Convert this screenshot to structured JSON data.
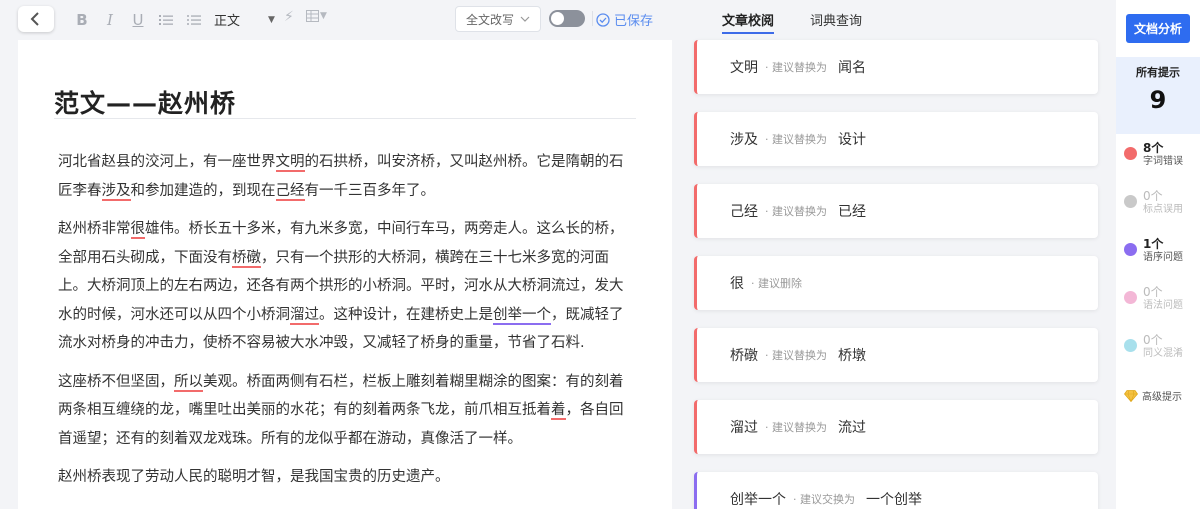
{
  "toolbar": {
    "style_label": "正文",
    "rewrite_label": "全文改写",
    "saved_label": "已保存"
  },
  "document": {
    "title": "范文——赵州桥",
    "paragraphs": [
      [
        {
          "t": "河北省赵县的洨河上，有一座世界"
        },
        {
          "t": "文明",
          "m": "err"
        },
        {
          "t": "的石拱桥，叫安济桥，又叫赵州桥。它是隋朝的石匠李春"
        },
        {
          "t": "涉及",
          "m": "err"
        },
        {
          "t": "和参加建造的，到现在"
        },
        {
          "t": "己经",
          "m": "err"
        },
        {
          "t": "有一千三百多年了。"
        }
      ],
      [
        {
          "t": "赵州桥非常"
        },
        {
          "t": "很",
          "m": "err"
        },
        {
          "t": "雄伟。桥长五十多米，有九米多宽，中间行车马，两旁走人。这么长的桥，全部用石头砌成，下面没有"
        },
        {
          "t": "桥礅",
          "m": "err"
        },
        {
          "t": "，只有一个拱形的大桥洞，横跨在三十七米多宽的河面上。大桥洞顶上的左右两边，还各有两个拱形的小桥洞。平时，河水从大桥洞流过，发大水的时候，河水还可以从四个小桥洞"
        },
        {
          "t": "溜过",
          "m": "err"
        },
        {
          "t": "。这种设计，在建桥史上是"
        },
        {
          "t": "创举一个",
          "m": "ord"
        },
        {
          "t": "，既减轻了流水对桥身的冲击力，使桥不容易被大水冲毁，又减轻了桥身的重量，节省了石料."
        }
      ],
      [
        {
          "t": "这座桥不但坚固，"
        },
        {
          "t": "所以",
          "m": "err"
        },
        {
          "t": "美观。桥面两侧有石栏，栏板上雕刻着糊里糊涂的图案：有的刻着两条相互缠绕的龙，嘴里吐出美丽的水花；有的刻着两条飞龙，前爪相互抵着"
        },
        {
          "t": "着",
          "m": "err"
        },
        {
          "t": "，各自回首遥望；还有的刻着双龙戏珠。所有的龙似乎都在游动，真像活了一样。"
        }
      ],
      [
        {
          "t": "赵州桥表现了劳动人民的聪明才智，是我国宝贵的历史遗产。"
        }
      ]
    ]
  },
  "tabs": [
    {
      "label": "文章校阅",
      "active": true
    },
    {
      "label": "词典查询",
      "active": false
    }
  ],
  "suggestions": [
    {
      "original": "文明",
      "hint": "· 建议替换为",
      "replacement": "闻名",
      "color": "#f26b6b"
    },
    {
      "original": "涉及",
      "hint": "· 建议替换为",
      "replacement": "设计",
      "color": "#f26b6b"
    },
    {
      "original": "己经",
      "hint": "· 建议替换为",
      "replacement": "已经",
      "color": "#f26b6b"
    },
    {
      "original": "很",
      "hint": "· 建议删除",
      "replacement": "",
      "color": "#f26b6b"
    },
    {
      "original": "桥礅",
      "hint": "· 建议替换为",
      "replacement": "桥墩",
      "color": "#f26b6b"
    },
    {
      "original": "溜过",
      "hint": "· 建议替换为",
      "replacement": "流过",
      "color": "#f26b6b"
    },
    {
      "original": "创举一个",
      "hint": "· 建议交换为",
      "replacement": "一个创举",
      "color": "#8b6df0"
    }
  ],
  "sidebar": {
    "analyze_label": "文档分析",
    "all_label": "所有提示",
    "all_count": "9",
    "categories": [
      {
        "count": "8个",
        "label": "字词错误",
        "color": "#f26b6b",
        "dim": false
      },
      {
        "count": "0个",
        "label": "标点误用",
        "color": "#c9c9c9",
        "dim": true
      },
      {
        "count": "1个",
        "label": "语序问题",
        "color": "#8b6df0",
        "dim": false
      },
      {
        "count": "0个",
        "label": "语法问题",
        "color": "#f3b7d6",
        "dim": true
      },
      {
        "count": "0个",
        "label": "同义混淆",
        "color": "#a8e0ec",
        "dim": true
      }
    ],
    "premium_label": "高级提示"
  },
  "colors": {
    "accent": "#2e6cf0",
    "error": "#f26b6b",
    "order": "#8b6df0"
  }
}
